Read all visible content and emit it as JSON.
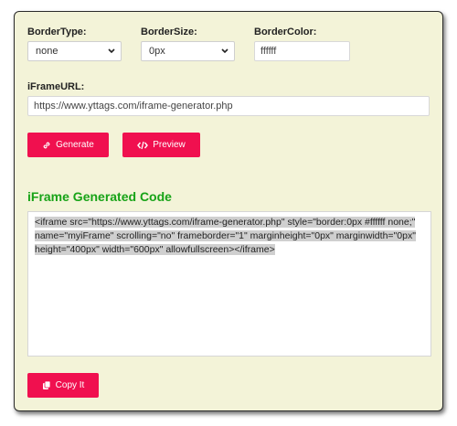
{
  "form": {
    "border_type": {
      "label": "BorderType:",
      "value": "none"
    },
    "border_size": {
      "label": "BorderSize:",
      "value": "0px"
    },
    "border_color": {
      "label": "BorderColor:",
      "value": "ffffff"
    },
    "iframe_url": {
      "label": "iFrameURL:",
      "value": "https://www.yttags.com/iframe-generator.php"
    }
  },
  "buttons": {
    "generate": "Generate",
    "preview": "Preview",
    "copy": "Copy It"
  },
  "output": {
    "heading": "iFrame Generated Code",
    "code": "<iframe src=\"https://www.yttags.com/iframe-generator.php\" style=\"border:0px #ffffff none;\" name=\"myiFrame\" scrolling=\"no\" frameborder=\"1\" marginheight=\"0px\" marginwidth=\"0px\" height=\"400px\" width=\"600px\" allowfullscreen></iframe>"
  },
  "colors": {
    "accent": "#f0104f",
    "heading": "#17a317",
    "panel_bg": "#f3f3d8"
  },
  "icons": {
    "generate": "link-icon",
    "preview": "code-icon",
    "copy": "copy-icon"
  }
}
